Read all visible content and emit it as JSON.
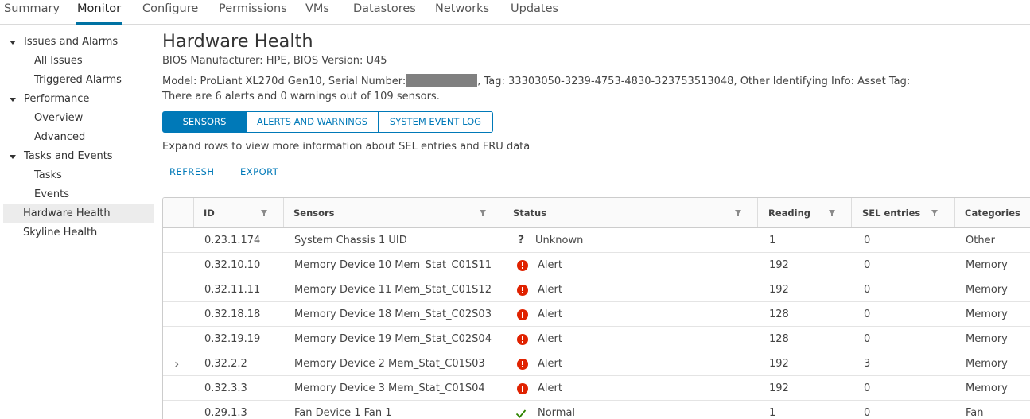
{
  "top_tabs": [
    "Summary",
    "Monitor",
    "Configure",
    "Permissions",
    "VMs",
    "Datastores",
    "Networks",
    "Updates"
  ],
  "active_tab": "Monitor",
  "sidebar": {
    "issues_and_alarms": "Issues and Alarms",
    "all_issues": "All Issues",
    "triggered_alarms": "Triggered Alarms",
    "performance": "Performance",
    "overview": "Overview",
    "advanced": "Advanced",
    "tasks_and_events": "Tasks and Events",
    "tasks": "Tasks",
    "events": "Events",
    "hardware_health": "Hardware Health",
    "skyline_health": "Skyline Health"
  },
  "main": {
    "title": "Hardware Health",
    "bios_line": "BIOS Manufacturer: HPE, BIOS Version: U45",
    "model_prefix": "Model: ProLiant XL270d Gen10, Serial Number:",
    "model_suffix": ", Tag: 33303050-3239-4753-4830-323753513048, Other Identifying Info: Asset Tag:",
    "alerts_summary": "There are 6 alerts and 0 warnings out of 109 sensors.",
    "tabs": {
      "sensors": "SENSORS",
      "alerts": "ALERTS AND WARNINGS",
      "sel": "SYSTEM EVENT LOG"
    },
    "hint": "Expand rows to view more information about SEL entries and FRU data",
    "refresh": "REFRESH",
    "export": "EXPORT"
  },
  "grid": {
    "columns": {
      "id": "ID",
      "sensors": "Sensors",
      "status": "Status",
      "reading": "Reading",
      "sel_entries": "SEL entries",
      "categories": "Categories"
    },
    "rows": [
      {
        "id": "0.23.1.174",
        "sensor": "System Chassis 1 UID",
        "status": "Unknown",
        "status_icon": "unknown-icon",
        "reading": "1",
        "sel": "0",
        "category": "Other"
      },
      {
        "id": "0.32.10.10",
        "sensor": "Memory Device 10 Mem_Stat_C01S11",
        "status": "Alert",
        "status_icon": "alert-icon",
        "reading": "192",
        "sel": "0",
        "category": "Memory"
      },
      {
        "id": "0.32.11.11",
        "sensor": "Memory Device 11 Mem_Stat_C01S12",
        "status": "Alert",
        "status_icon": "alert-icon",
        "reading": "192",
        "sel": "0",
        "category": "Memory"
      },
      {
        "id": "0.32.18.18",
        "sensor": "Memory Device 18 Mem_Stat_C02S03",
        "status": "Alert",
        "status_icon": "alert-icon",
        "reading": "128",
        "sel": "0",
        "category": "Memory"
      },
      {
        "id": "0.32.19.19",
        "sensor": "Memory Device 19 Mem_Stat_C02S04",
        "status": "Alert",
        "status_icon": "alert-icon",
        "reading": "128",
        "sel": "0",
        "category": "Memory"
      },
      {
        "id": "0.32.2.2",
        "sensor": "Memory Device 2 Mem_Stat_C01S03",
        "status": "Alert",
        "status_icon": "alert-icon",
        "reading": "192",
        "sel": "3",
        "category": "Memory"
      },
      {
        "id": "0.32.3.3",
        "sensor": "Memory Device 3 Mem_Stat_C01S04",
        "status": "Alert",
        "status_icon": "alert-icon",
        "reading": "192",
        "sel": "0",
        "category": "Memory"
      },
      {
        "id": "0.29.1.3",
        "sensor": "Fan Device 1 Fan 1",
        "status": "Normal",
        "status_icon": "check-icon",
        "reading": "1",
        "sel": "0",
        "category": "Fan"
      }
    ]
  },
  "colors": {
    "accent": "#0079b8",
    "alert": "#e02200",
    "ok": "#2f8400"
  }
}
